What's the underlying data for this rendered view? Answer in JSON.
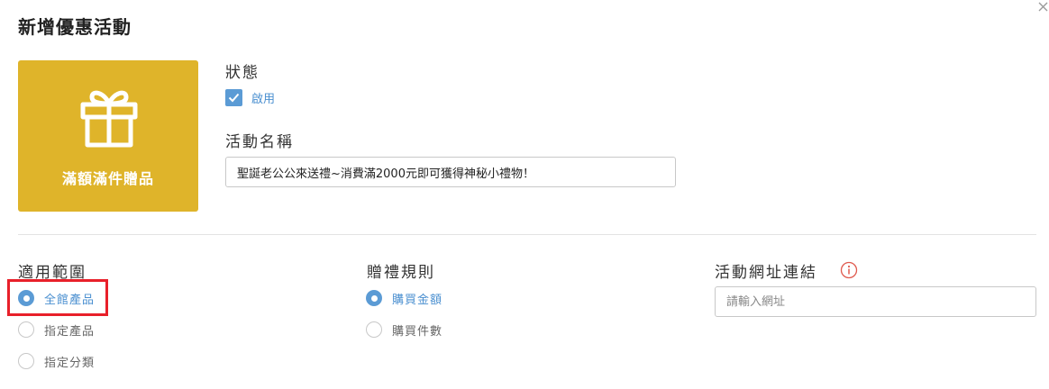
{
  "dialog": {
    "title": "新增優惠活動",
    "close_icon": "close-icon"
  },
  "gift_card": {
    "label": "滿額滿件贈品",
    "icon": "gift-icon",
    "color": "#dfb42a"
  },
  "status": {
    "label": "狀態",
    "checkbox_label": "啟用",
    "checked": true
  },
  "activity_name": {
    "label": "活動名稱",
    "value": "聖誕老公公來送禮~消費滿2000元即可獲得神秘小禮物！"
  },
  "scope": {
    "label": "適用範圍",
    "options": [
      {
        "label": "全館產品",
        "selected": true
      },
      {
        "label": "指定產品",
        "selected": false
      },
      {
        "label": "指定分類",
        "selected": false
      }
    ]
  },
  "gift_rule": {
    "label": "贈禮規則",
    "options": [
      {
        "label": "購買金額",
        "selected": true
      },
      {
        "label": "購買件數",
        "selected": false
      }
    ]
  },
  "activity_link": {
    "label": "活動網址連結",
    "info_icon": "info-icon",
    "placeholder": "請輸入網址",
    "value": ""
  },
  "colors": {
    "accent": "#5b9bd5",
    "highlight": "#e8202a",
    "info": "#e05a4e"
  }
}
